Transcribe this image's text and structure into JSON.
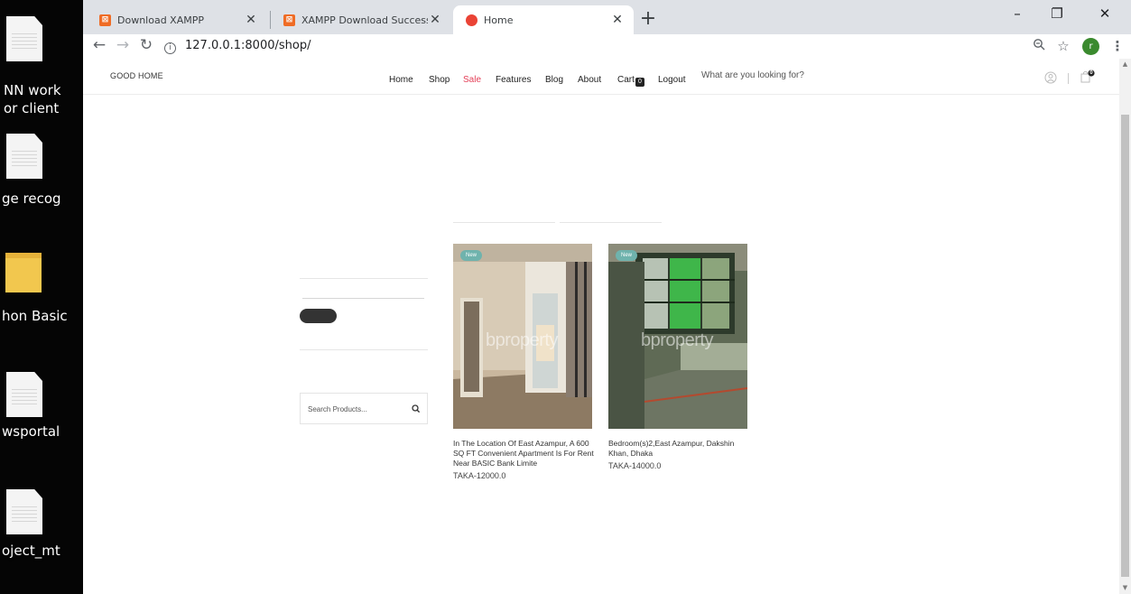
{
  "desktop": {
    "icons": [
      {
        "label": "NN work\nor client",
        "icon": "file-icon"
      },
      {
        "label": "ge recog",
        "icon": "file-icon"
      },
      {
        "label": "hon Basic",
        "icon": "folder-icon"
      },
      {
        "label": "wsportal",
        "icon": "file-icon"
      },
      {
        "label": "oject_mt",
        "icon": "file-icon"
      }
    ]
  },
  "browser": {
    "tabs": [
      {
        "title": "Download XAMPP",
        "favicon": "xampp-icon",
        "active": false
      },
      {
        "title": "XAMPP Download Success",
        "favicon": "xampp-icon",
        "active": false
      },
      {
        "title": "Home",
        "favicon": "red-dot-icon",
        "active": true
      }
    ],
    "new_tab_label": "+",
    "url": "127.0.0.1:8000/shop/",
    "profile_initial": "r",
    "window_controls": {
      "minimize": "–",
      "maximize": "❐",
      "close": "✕"
    }
  },
  "site": {
    "logo": "GOOD HOME",
    "nav": [
      {
        "label": "Home"
      },
      {
        "label": "Shop"
      },
      {
        "label": "Sale"
      },
      {
        "label": "Features"
      },
      {
        "label": "Blog"
      },
      {
        "label": "About"
      },
      {
        "label": "Cart"
      },
      {
        "label": "Logout"
      }
    ],
    "cart_count": "0",
    "header_search_hint": "What are you looking for?",
    "bag_count": "0",
    "accent_sale_color": "#e4425a"
  },
  "sidebar": {
    "search_placeholder": "Search Products..."
  },
  "products": [
    {
      "badge": "New",
      "watermark": "bproperty",
      "title": "In The Location Of East Azampur, A 600 SQ FT Convenient Apartment Is For Rent Near BASIC Bank Limite",
      "price": "TAKA-12000.0"
    },
    {
      "badge": "New",
      "watermark": "bproperty",
      "title": "Bedroom(s)2,East Azampur, Dakshin Khan, Dhaka",
      "price": "TAKA-14000.0"
    }
  ]
}
